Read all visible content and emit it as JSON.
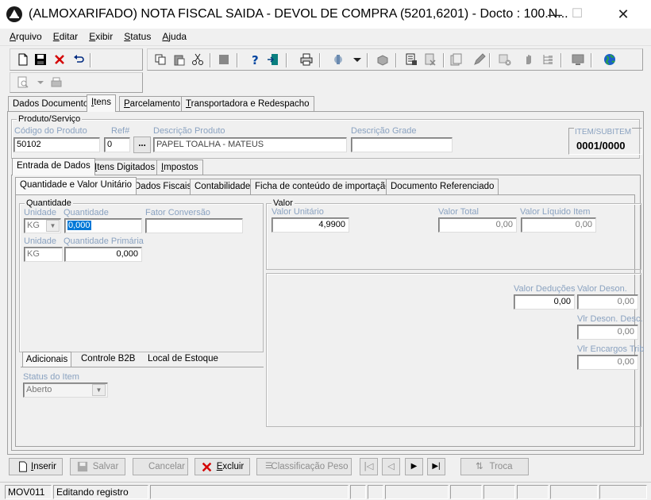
{
  "window": {
    "title": "(ALMOXARIFADO) NOTA FISCAL SAIDA - DEVOL DE COMPRA (5201,6201) - Docto : 100.N...",
    "minimize": "—",
    "maximize": "☐",
    "close": "✕"
  },
  "menu": [
    {
      "u": "A",
      "rest": "rquivo"
    },
    {
      "u": "E",
      "rest": "ditar"
    },
    {
      "u": "E",
      "rest": "xibir"
    },
    {
      "u": "S",
      "rest": "tatus"
    },
    {
      "u": "A",
      "rest": "juda"
    }
  ],
  "main_tabs": [
    {
      "label": "Dados Documento"
    },
    {
      "u": "I",
      "rest": "tens"
    },
    {
      "u": "P",
      "rest": "arcelamento"
    },
    {
      "u": "T",
      "rest": "ransportadora e Redespacho"
    }
  ],
  "produto": {
    "group_label": "Produto/Serviço",
    "codigo_label": "Código do Produto",
    "codigo_value": "50102",
    "ref_label": "Ref#",
    "ref_value": "0",
    "browse": "...",
    "descricao_label": "Descrição Produto",
    "descricao_value": "PAPEL TOALHA - MATEUS",
    "grade_label": "Descrição Grade",
    "grade_value": "",
    "item_label": "ITEM/SUBITEM",
    "item_value": "0001/0000"
  },
  "item_tabs": [
    {
      "label": "Entrada de Dados"
    },
    {
      "u": "I",
      "rest": "tens Digitados"
    },
    {
      "u": "I",
      "rest": "mpostos"
    }
  ],
  "sub_tabs": [
    {
      "label": "Quantidade e Valor Unitário"
    },
    {
      "label": "Dados Fiscais"
    },
    {
      "label": "Contabilidade"
    },
    {
      "label": "Ficha de conteúdo de importação"
    },
    {
      "label": "Documento Referenciado"
    }
  ],
  "quantidade": {
    "group_label": "Quantidade",
    "unidade_label": "Unidade",
    "unidade_value": "KG",
    "quantidade_label": "Quantidade",
    "quantidade_value": "0,000",
    "fator_label": "Fator Conversão",
    "fator_value": "",
    "unidade2_label": "Unidade",
    "unidade2_value": "KG",
    "qprimaria_label": "Quantidade Primária",
    "qprimaria_value": "0,000"
  },
  "valor": {
    "group_label": "Valor",
    "unitario_label": "Valor Unitário",
    "unitario_value": "4,9900",
    "total_label": "Valor Total",
    "total_value": "0,00",
    "liquido_label": "Valor Líquido Item",
    "liquido_value": "0,00",
    "deducoes_label": "Valor Deduções",
    "deducoes_value": "0,00",
    "deson_label": "Valor Deson.",
    "deson_value": "0,00",
    "deson_desc_label": "Vlr Deson. Desc.",
    "deson_desc_value": "0,00",
    "encargos_label": "Vlr Encargos Trib",
    "encargos_value": "0,00"
  },
  "bottom_tabs": [
    {
      "label": "Adicionais"
    },
    {
      "label": "Controle B2B"
    },
    {
      "label": "Local de Estoque"
    }
  ],
  "status_item": {
    "label": "Status do Item",
    "value": "Aberto"
  },
  "actions": {
    "inserir": {
      "u": "I",
      "rest": "nserir"
    },
    "salvar": "Salvar",
    "cancelar": "Cancelar",
    "excluir": {
      "u": "E",
      "rest": "xcluir"
    },
    "classificacao": "Classificação Peso",
    "troca": "Troca"
  },
  "statusbar": {
    "module": "MOV011",
    "message": "Editando registro"
  },
  "colors": {
    "label_blue": "#8aa2c0",
    "selection": "#0078d7",
    "delete_red": "#d40000"
  }
}
